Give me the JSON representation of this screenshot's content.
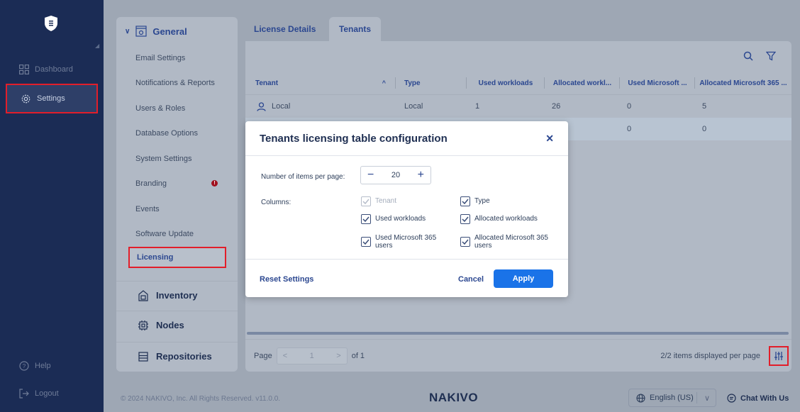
{
  "rail": {
    "items": [
      {
        "label": "Dashboard"
      },
      {
        "label": "Settings"
      },
      {
        "label": "Help"
      },
      {
        "label": "Logout"
      }
    ]
  },
  "settings_panel": {
    "header": "General",
    "items": [
      {
        "label": "Email Settings"
      },
      {
        "label": "Notifications & Reports"
      },
      {
        "label": "Users & Roles"
      },
      {
        "label": "Database Options"
      },
      {
        "label": "System Settings"
      },
      {
        "label": "Branding"
      },
      {
        "label": "Events"
      },
      {
        "label": "Software Update"
      },
      {
        "label": "Licensing"
      }
    ],
    "groups": [
      {
        "label": "Inventory"
      },
      {
        "label": "Nodes"
      },
      {
        "label": "Repositories"
      }
    ]
  },
  "tabs": [
    {
      "label": "License Details"
    },
    {
      "label": "Tenants"
    }
  ],
  "table": {
    "columns": [
      "Tenant",
      "Type",
      "Used workloads",
      "Allocated workl...",
      "Used Microsoft ...",
      "Allocated Microsoft 365 ..."
    ],
    "rows": [
      [
        "Local",
        "Local",
        "1",
        "26",
        "0",
        "5"
      ],
      [
        "",
        "",
        "",
        "",
        "0",
        "0"
      ]
    ]
  },
  "pager": {
    "page_label": "Page",
    "page_value": "1",
    "of_label": "of 1",
    "items_per_page": "2/2 items displayed per page"
  },
  "footer": {
    "copyright": "© 2024 NAKIVO, Inc. All Rights Reserved. v11.0.0.",
    "brand": "NAKIVO",
    "language": "English (US)",
    "chat": "Chat With Us"
  },
  "modal": {
    "title": "Tenants licensing table configuration",
    "items_label": "Number of items per page:",
    "items_value": "20",
    "columns_label": "Columns:",
    "checkboxes": [
      {
        "label": "Tenant",
        "checked": true,
        "disabled": true
      },
      {
        "label": "Type",
        "checked": true
      },
      {
        "label": "Used workloads",
        "checked": true
      },
      {
        "label": "Allocated workloads",
        "checked": true
      },
      {
        "label": "Used Microsoft 365 users",
        "checked": true
      },
      {
        "label": "Allocated Microsoft 365 users",
        "checked": true
      }
    ],
    "reset": "Reset Settings",
    "cancel": "Cancel",
    "apply": "Apply"
  },
  "colors": {
    "rail": "#1b2c55",
    "accent": "#1a73e8",
    "highlight": "#e21e2a"
  }
}
